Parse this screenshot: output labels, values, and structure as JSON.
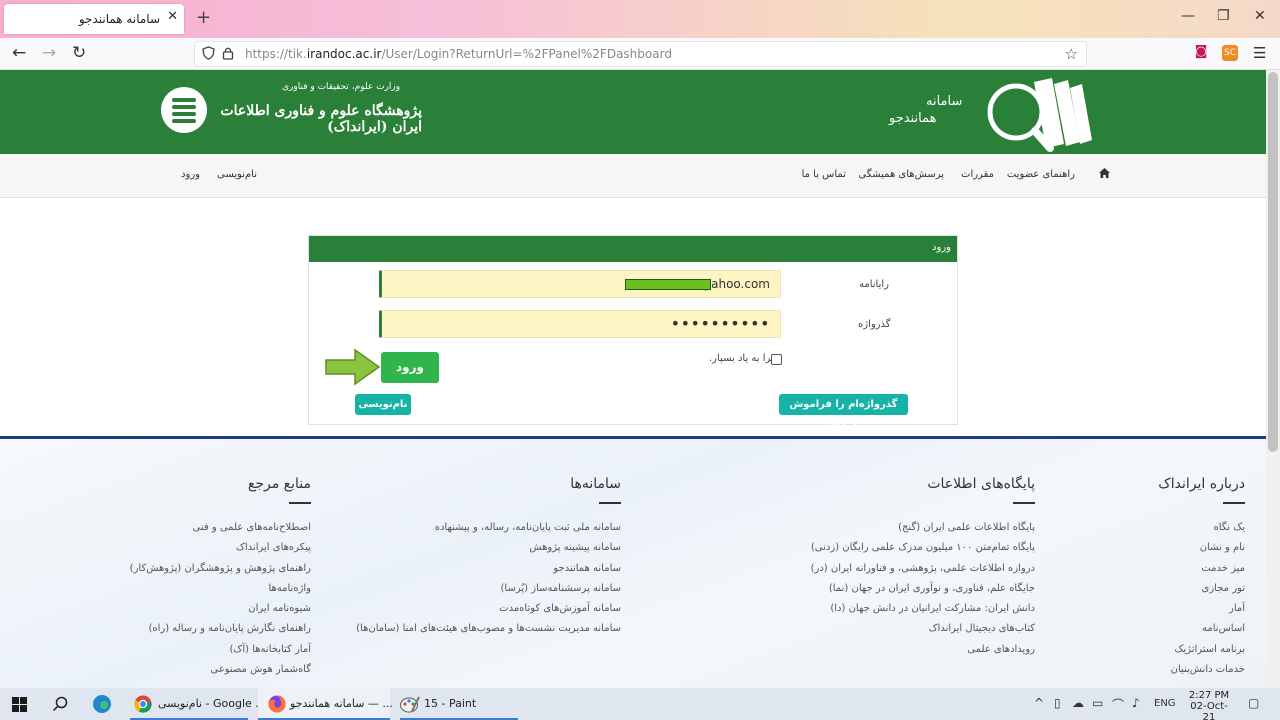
{
  "browser": {
    "tab_title": "سامانه همانندجو",
    "url_prefix": "https://tik.",
    "url_domain": "irandoc.ac.ir",
    "url_path": "/User/Login?ReturnUrl=%2FPanel%2FDashboard",
    "ext_label": "SC"
  },
  "header": {
    "ministry": "وزارت علوم، تحقیقات و فناوری",
    "org_name": "پژوهشگاه علوم و فناوری اطلاعات ایران (ایرانداک)",
    "brand_line1": "سامانه",
    "brand_line2": "همانندجو"
  },
  "nav": {
    "membership_guide": "راهنمای عضویت",
    "regulations": "مقررات",
    "faq": "پرسش‌های همیشگی",
    "contact": "تماس با ما",
    "register": "نام‌نویسی",
    "login": "ورود"
  },
  "login": {
    "panel_title": "ورود",
    "username_label": "رایانامه",
    "username_value": "@yahoo.com",
    "password_label": "گذرواژه",
    "password_value": "••••••••••",
    "remember_label": "مرا به یاد بسپار.",
    "submit_label": "ورود",
    "forgot_label": "گذرواژه‌ام را فراموش کرده‌ام.",
    "register_label": "نام‌نویسی"
  },
  "footer": {
    "about": {
      "title": "درباره ایرانداک",
      "items": [
        "یک نگاه",
        "نام و نشان",
        "میز خدمت",
        "تور مجازی",
        "آمار",
        "اساس‌نامه",
        "برنامه استراتژیک",
        "خدمات دانش‌بنیان"
      ]
    },
    "databases": {
      "title": "پایگاه‌های اطلاعات",
      "items": [
        "پایگاه اطلاعات علمی ایران (گنج)",
        "پایگاه تمام‌متن ۱۰۰ میلیون مدرک علمی رایگان (زدنی)",
        "دروازه اطلاعات علمی، پژوهشی، و فناورانه ایران (در)",
        "جایگاه علم، فناوری، و نوآوری ایران در جهان (نما)",
        "دانش ایران: مشارکت ایرانیان در دانش جهان (دا)",
        "کتاب‌های دیجیتال ایرانداک",
        "رویدادهای علمی"
      ]
    },
    "systems": {
      "title": "سامانه‌ها",
      "items": [
        "سامانه ملی ثبت پایان‌نامه، رساله، و پیشنهاده",
        "سامانه پیشینه پژوهش",
        "سامانه همانندجو",
        "سامانه پرسشنامه‌ساز (پُرسا)",
        "سامانه آموزش‌های کوتاه‌مدت",
        "سامانه مدیریت نشست‌ها و مصوب‌های هیئت‌های امنا (سامان‌ها)"
      ]
    },
    "references": {
      "title": "منابع مرجع",
      "items": [
        "اصطلاح‌نامه‌های علمی و فنی",
        "پیکره‌های ایرانداک",
        "راهنمای پژوهش و پژوهشگران (پژوهش‌کار)",
        "واژه‌نامه‌ها",
        "شیوه‌نامه ایران",
        "راهنمای نگارش پایان‌نامه و رساله (راه)",
        "آمار کتابخانه‌ها (آک)",
        "گاه‌شمار هوش مصنوعی"
      ]
    }
  },
  "taskbar": {
    "chrome_label": "نام‌نویسی - Google ...",
    "firefox_label": "سامانه همانندجو — ...",
    "paint_label": "15 - Paint",
    "lang": "ENG",
    "time": "2:27 PM",
    "date": "02-Oct-21"
  },
  "colors": {
    "brand_green": "#2a7f39",
    "button_green": "#2fb54a",
    "button_teal": "#16b3a6",
    "field_yellow": "#fdf6c4",
    "divider_blue": "#1f3c80"
  }
}
